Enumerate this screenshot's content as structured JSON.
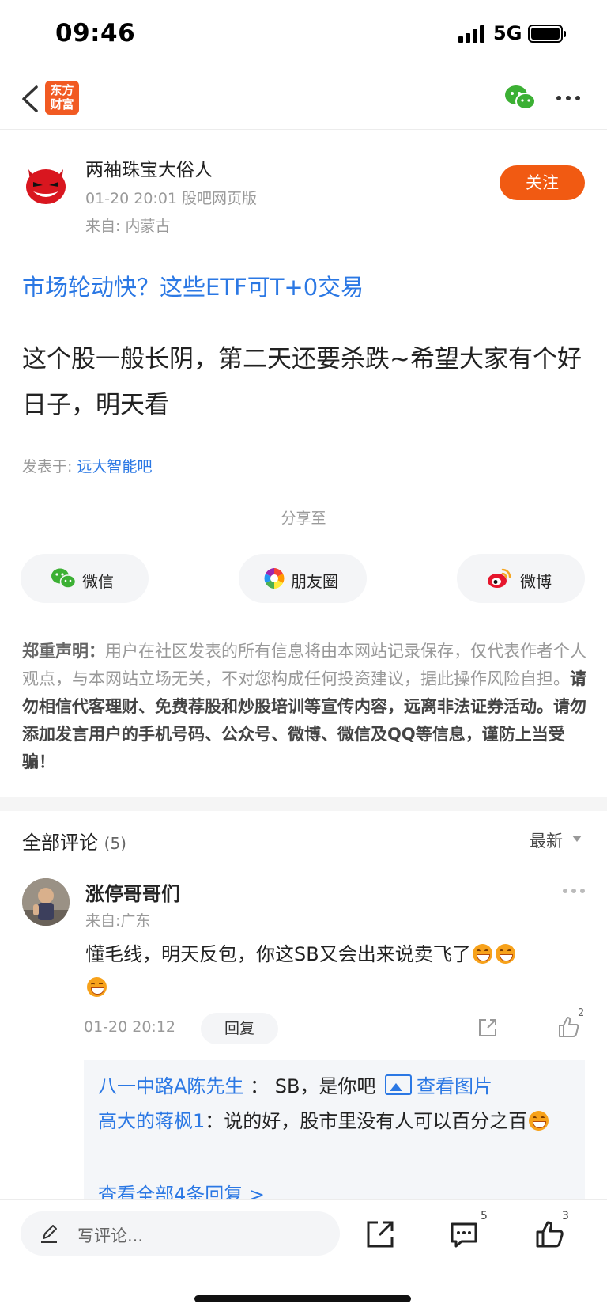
{
  "status_bar": {
    "time": "09:46",
    "network": "5G"
  },
  "nav": {
    "logo_text": "东方财富",
    "logo_line1": "东方",
    "logo_line2": "财富"
  },
  "author": {
    "name": "两袖珠宝大俗人",
    "meta": "01-20 20:01 股吧网页版",
    "from": "来自: 内蒙古",
    "follow_label": "关注"
  },
  "ad_link": "市场轮动快？这些ETF可T+0交易",
  "post": {
    "text": "这个股一般长阴，第二天还要杀跌~希望大家有个好日子，明天看",
    "posted_in_label": "发表于: ",
    "bar_name": "远大智能吧"
  },
  "share": {
    "title": "分享至",
    "buttons": [
      {
        "label": "微信",
        "icon": "wechat-icon"
      },
      {
        "label": "朋友圈",
        "icon": "moments-icon"
      },
      {
        "label": "微博",
        "icon": "weibo-icon"
      }
    ]
  },
  "disclaimer": {
    "head": "郑重声明：",
    "body": "用户在社区发表的所有信息将由本网站记录保存，仅代表作者个人观点，与本网站立场无关，不对您构成任何投资建议，据此操作风险自担。",
    "strong": "请勿相信代客理财、免费荐股和炒股培训等宣传内容，远离非法证券活动。请勿添加发言用户的手机号码、公众号、微博、微信及QQ等信息，谨防上当受骗！"
  },
  "comments": {
    "title": "全部评论",
    "count": "(5)",
    "sort_label": "最新",
    "items": [
      {
        "name": "涨停哥哥们",
        "from": "来自:广东",
        "text": "懂毛线，明天反包，你这SB又会出来说卖飞了",
        "time": "01-20 20:12",
        "reply_label": "回复",
        "like_count": "2",
        "replies": [
          {
            "name": "八一中路A陈先生",
            "sep": "：",
            "text": "SB，是你吧",
            "image_link": "查看图片"
          },
          {
            "name": "高大的蒋枫1",
            "sep": "：",
            "text": "说的好，股市里没有人可以百分之百"
          }
        ],
        "view_all": "查看全部4条回复 >"
      }
    ]
  },
  "bottom_bar": {
    "placeholder": "写评论...",
    "comment_count": "5",
    "like_count": "3"
  },
  "colors": {
    "brand": "#f15a22",
    "link": "#2b78e4",
    "follow": "#f15a12",
    "wechat": "#3cb034"
  }
}
